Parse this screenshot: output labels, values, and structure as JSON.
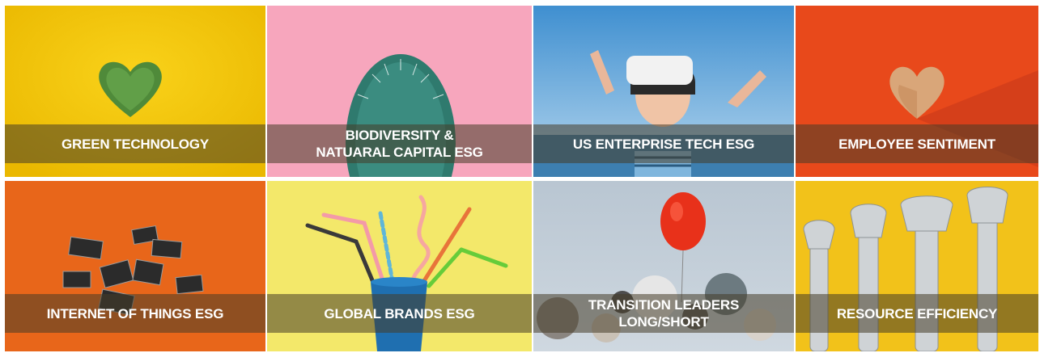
{
  "tiles": [
    {
      "label": "GREEN TECHNOLOGY",
      "bg": "#f5c400"
    },
    {
      "label": "BIODIVERSITY &\nNATUARAL CAPITAL ESG",
      "bg": "#f7a6bd"
    },
    {
      "label": "US ENTERPRISE TECH ESG",
      "bg": "#5fa3d6"
    },
    {
      "label": "EMPLOYEE SENTIMENT",
      "bg": "#e8491b"
    },
    {
      "label": "INTERNET OF THINGS ESG",
      "bg": "#e8661a"
    },
    {
      "label": "GLOBAL BRANDS ESG",
      "bg": "#f3e86a"
    },
    {
      "label": "TRANSITION LEADERS\nLONG/SHORT",
      "bg": "#a9b7c4"
    },
    {
      "label": "RESOURCE EFFICIENCY",
      "bg": "#f2c21a"
    }
  ],
  "icons": {
    "t0": "heart-moss-icon",
    "t1": "cactus-icon",
    "t2": "vr-headset-child-icon",
    "t3": "wooden-heart-icon",
    "t4": "microchips-icon",
    "t5": "drinking-straws-cup-icon",
    "t6": "red-balloon-icon",
    "t7": "wrenches-icon"
  }
}
